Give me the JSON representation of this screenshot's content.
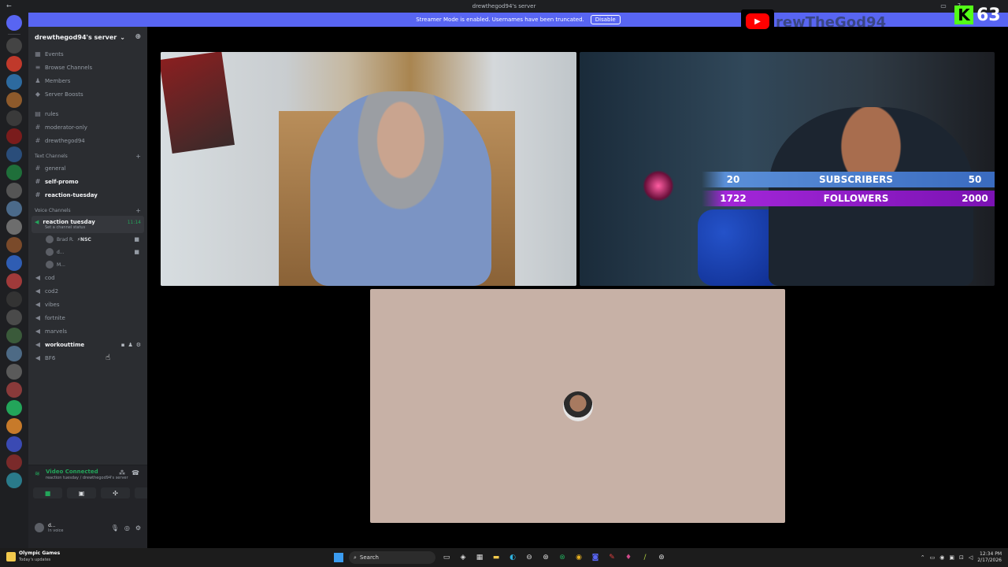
{
  "titlebar": {
    "title": "drewthegod94's server",
    "back": "←"
  },
  "banner": {
    "text": "Streamer Mode is enabled. Usernames have been truncated.",
    "disable_label": "Disable"
  },
  "server": {
    "name": "drewthegod94's server",
    "nav": [
      {
        "icon": "calendar-icon",
        "label": "Events"
      },
      {
        "icon": "browse-icon",
        "label": "Browse Channels"
      },
      {
        "icon": "members-icon",
        "label": "Members"
      },
      {
        "icon": "boost-icon",
        "label": "Server Boosts"
      }
    ],
    "top_channels": [
      "rules",
      "moderator-only",
      "drewthegod94"
    ],
    "text_category": "Text Channels",
    "text_channels": [
      {
        "name": "general",
        "bold": false
      },
      {
        "name": "self-promo",
        "bold": true
      },
      {
        "name": "reaction-tuesday",
        "bold": true
      }
    ],
    "voice_category": "Voice Channels",
    "active_voice": {
      "name": "reaction tuesday",
      "timer": "11:14",
      "status": "Set a channel status"
    },
    "members": [
      {
        "name": "Brad R.",
        "tag": "⚡NSC"
      },
      {
        "name": "d..."
      },
      {
        "name": "M..."
      }
    ],
    "voice_channels": [
      {
        "name": "cod",
        "bold": false
      },
      {
        "name": "cod2",
        "bold": false
      },
      {
        "name": "vibes",
        "bold": false
      },
      {
        "name": "fortnite",
        "bold": false
      },
      {
        "name": "marvels",
        "bold": false
      },
      {
        "name": "workouttime",
        "bold": true
      },
      {
        "name": "BF6",
        "bold": false
      }
    ]
  },
  "voice_connection": {
    "title": "Video Connected",
    "subtitle": "reaction tuesday / drewthegod94's server"
  },
  "user": {
    "name": "d...",
    "status": "In voice"
  },
  "overlay": {
    "subscribers": {
      "current": "20",
      "label": "SUBSCRIBERS",
      "goal": "50"
    },
    "followers": {
      "current": "1722",
      "label": "FOLLOWERS",
      "goal": "2000"
    },
    "youtube_name": "rewTheGod94",
    "kick_count": "63",
    "kick_letter": "K"
  },
  "taskbar": {
    "weather_title": "Olympic Games",
    "weather_sub": "Today's updates",
    "search_label": "Search",
    "time": "12:34 PM",
    "date": "2/17/2026"
  },
  "colors": {
    "accent": "#5865f2",
    "green": "#23a55a",
    "subs_bar": "#3a6bbf",
    "follow_bar": "#7b12b3",
    "kick": "#53fc18"
  }
}
